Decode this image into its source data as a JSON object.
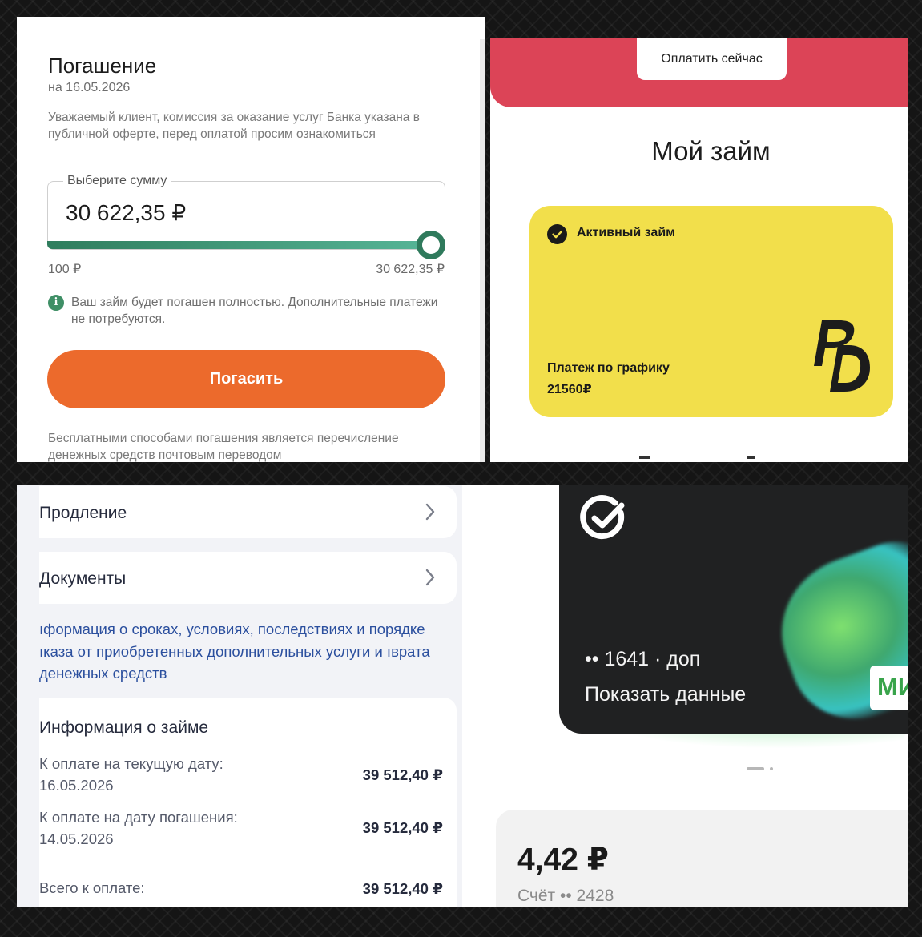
{
  "repayment": {
    "title": "Погашение",
    "date": "на 16.05.2026",
    "notice": "Уважаемый клиент, комиссия за оказание услуг Банка указана в публичной оферте, перед оплатой просим ознакомиться",
    "amount_label": "Выберите сумму",
    "amount": "30 622,35 ₽",
    "slider_min": "100 ₽",
    "slider_max": "30 622,35 ₽",
    "slider_level": 1.0,
    "info": "Ваш займ будет погашен полностью. Дополнительные платежи не потребуются.",
    "pay_button": "Погасить",
    "free_methods": "Бесплатными способами погашения является перечисление денежных средств почтовым переводом",
    "accent": "#ec6a2c",
    "slider_color": "#2f7a5c"
  },
  "my_loan": {
    "pay_now_button": "Оплатить сейчас",
    "heading": "Мой займ",
    "status": "Активный займ",
    "schedule_label": "Платеж по графику",
    "schedule_value": "21560₽",
    "banner_color": "#dc4457",
    "card_color": "#f2df4b"
  },
  "loan_details": {
    "rows": [
      {
        "label": "Пpодление"
      },
      {
        "label": "Документы"
      }
    ],
    "links": "ıформация о сроках, условиях, последствиях и порядке ıказа от приобретенных дополнительных услуги и ıврата денежных средств",
    "info_title": "Информация о займе",
    "items": [
      {
        "label": "К оплате на текущую дату:",
        "date": "16.05.2026",
        "value": "39 512,40 ₽"
      },
      {
        "label": "К оплате на дату погашения:",
        "date": "14.05.2026",
        "value": "39 512,40 ₽"
      }
    ],
    "total_label": "Всего к оплате:",
    "total_value": "39 512,40 ₽",
    "link_color": "#2b4f9e"
  },
  "bank_card": {
    "card_number": "•• 1641 · доп",
    "show_data": "Показать данные",
    "payment_system": "МИ",
    "balance": "4,42 ₽",
    "account": "Счёт •• 2428"
  }
}
